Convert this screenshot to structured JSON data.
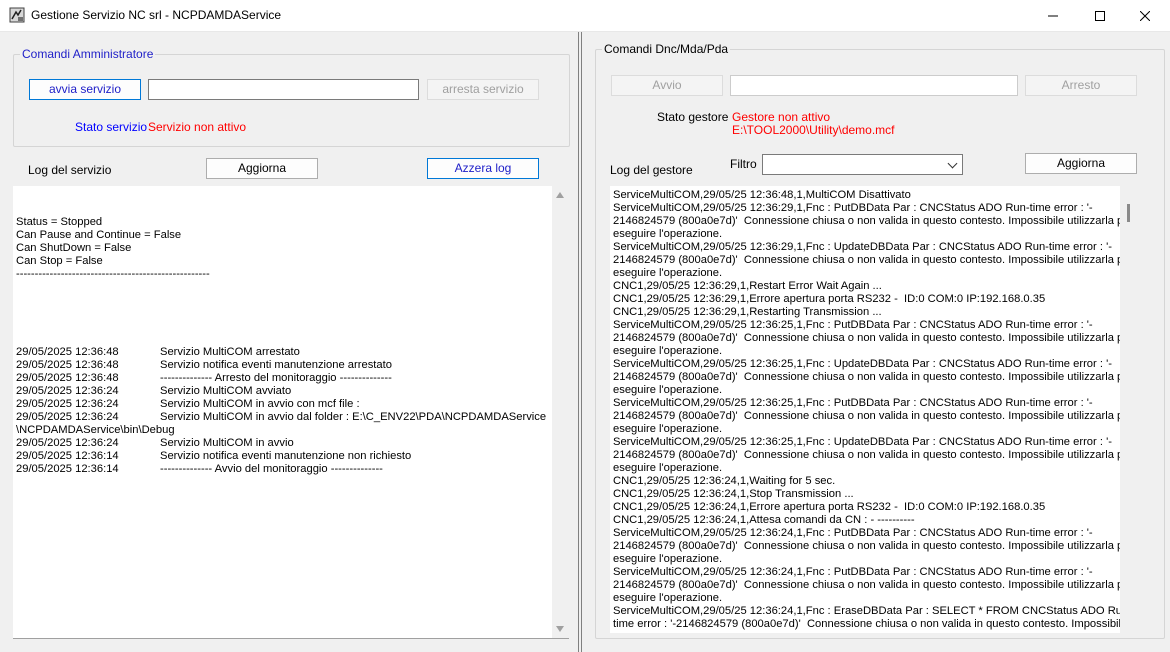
{
  "window": {
    "title": "Gestione Servizio NC srl - NCPDAMDAService",
    "min_glyph": "—",
    "max_glyph": "☐",
    "close_glyph": "✕"
  },
  "left": {
    "group_title": "Comandi Amministratore",
    "start_button": "avvia servizio",
    "service_input_value": "",
    "stop_button": "arresta servizio",
    "status_label": "Stato servizio",
    "status_value": "Servizio non attivo",
    "log_label": "Log del servizio",
    "refresh_button": "Aggiorna",
    "clear_button": "Azzera log",
    "log_header": [
      "Status = Stopped",
      "Can Pause and Continue = False",
      "Can ShutDown = False",
      "Can Stop = False",
      "----------------------------------------------------"
    ],
    "log_entries": [
      {
        "ts": "29/05/2025 12:36:48",
        "msg": "Servizio MultiCOM arrestato"
      },
      {
        "ts": "29/05/2025 12:36:48",
        "msg": "Servizio notifica eventi manutenzione arrestato"
      },
      {
        "ts": "29/05/2025 12:36:48",
        "msg": "-------------- Arresto del monitoraggio --------------"
      },
      {
        "ts": "29/05/2025 12:36:24",
        "msg": "Servizio MultiCOM avviato"
      },
      {
        "ts": "29/05/2025 12:36:24",
        "msg": "Servizio MultiCOM in avvio con mcf file :"
      },
      {
        "ts": "29/05/2025 12:36:24",
        "msg": "Servizio MultiCOM in avvio dal folder : E:\\C_ENV22\\PDA\\NCPDAMDAService"
      },
      {
        "ts": "",
        "msg": "",
        "cont": "\\NCPDAMDAService\\bin\\Debug"
      },
      {
        "ts": "29/05/2025 12:36:24",
        "msg": "Servizio MultiCOM in avvio"
      },
      {
        "ts": "29/05/2025 12:36:14",
        "msg": "Servizio notifica eventi manutenzione non richiesto"
      },
      {
        "ts": "29/05/2025 12:36:14",
        "msg": "-------------- Avvio del monitoraggio --------------"
      }
    ]
  },
  "right": {
    "group_title": "Comandi Dnc/Mda/Pda",
    "start_button": "Avvio",
    "manager_input_value": "",
    "stop_button": "Arresto",
    "status_label": "Stato gestore",
    "status_value": "Gestore non attivo",
    "status_path": "E:\\TOOL2000\\Utility\\demo.mcf",
    "log_label": "Log del gestore",
    "filter_label": "Filtro",
    "filter_value": "",
    "refresh_button": "Aggiorna",
    "log_lines": [
      "ServiceMultiCOM,29/05/25 12:36:48,1,MultiCOM Disattivato",
      "ServiceMultiCOM,29/05/25 12:36:29,1,Fnc : PutDBData Par : CNCStatus ADO Run-time error : '-",
      "2146824579 (800a0e7d)'  Connessione chiusa o non valida in questo contesto. Impossibile utilizzarla per",
      "eseguire l'operazione.",
      "ServiceMultiCOM,29/05/25 12:36:29,1,Fnc : UpdateDBData Par : CNCStatus ADO Run-time error : '-",
      "2146824579 (800a0e7d)'  Connessione chiusa o non valida in questo contesto. Impossibile utilizzarla per",
      "eseguire l'operazione.",
      "CNC1,29/05/25 12:36:29,1,Restart Error Wait Again ...",
      "CNC1,29/05/25 12:36:29,1,Errore apertura porta RS232 -  ID:0 COM:0 IP:192.168.0.35",
      "CNC1,29/05/25 12:36:29,1,Restarting Transmission ...",
      "ServiceMultiCOM,29/05/25 12:36:25,1,Fnc : PutDBData Par : CNCStatus ADO Run-time error : '-",
      "2146824579 (800a0e7d)'  Connessione chiusa o non valida in questo contesto. Impossibile utilizzarla per",
      "eseguire l'operazione.",
      "ServiceMultiCOM,29/05/25 12:36:25,1,Fnc : UpdateDBData Par : CNCStatus ADO Run-time error : '-",
      "2146824579 (800a0e7d)'  Connessione chiusa o non valida in questo contesto. Impossibile utilizzarla per",
      "eseguire l'operazione.",
      "ServiceMultiCOM,29/05/25 12:36:25,1,Fnc : PutDBData Par : CNCStatus ADO Run-time error : '-",
      "2146824579 (800a0e7d)'  Connessione chiusa o non valida in questo contesto. Impossibile utilizzarla per",
      "eseguire l'operazione.",
      "ServiceMultiCOM,29/05/25 12:36:25,1,Fnc : UpdateDBData Par : CNCStatus ADO Run-time error : '-",
      "2146824579 (800a0e7d)'  Connessione chiusa o non valida in questo contesto. Impossibile utilizzarla per",
      "eseguire l'operazione.",
      "CNC1,29/05/25 12:36:24,1,Waiting for 5 sec.",
      "CNC1,29/05/25 12:36:24,1,Stop Transmission ...",
      "CNC1,29/05/25 12:36:24,1,Errore apertura porta RS232 -  ID:0 COM:0 IP:192.168.0.35",
      "CNC1,29/05/25 12:36:24,1,Attesa comandi da CN : - ----------",
      "ServiceMultiCOM,29/05/25 12:36:24,1,Fnc : PutDBData Par : CNCStatus ADO Run-time error : '-",
      "2146824579 (800a0e7d)'  Connessione chiusa o non valida in questo contesto. Impossibile utilizzarla per",
      "eseguire l'operazione.",
      "ServiceMultiCOM,29/05/25 12:36:24,1,Fnc : PutDBData Par : CNCStatus ADO Run-time error : '-",
      "2146824579 (800a0e7d)'  Connessione chiusa o non valida in questo contesto. Impossibile utilizzarla per",
      "eseguire l'operazione.",
      "ServiceMultiCOM,29/05/25 12:36:24,1,Fnc : EraseDBData Par : SELECT * FROM CNCStatus ADO Run-",
      "time error : '-2146824579 (800a0e7d)'  Connessione chiusa o non valida in questo contesto. Impossibile"
    ]
  }
}
